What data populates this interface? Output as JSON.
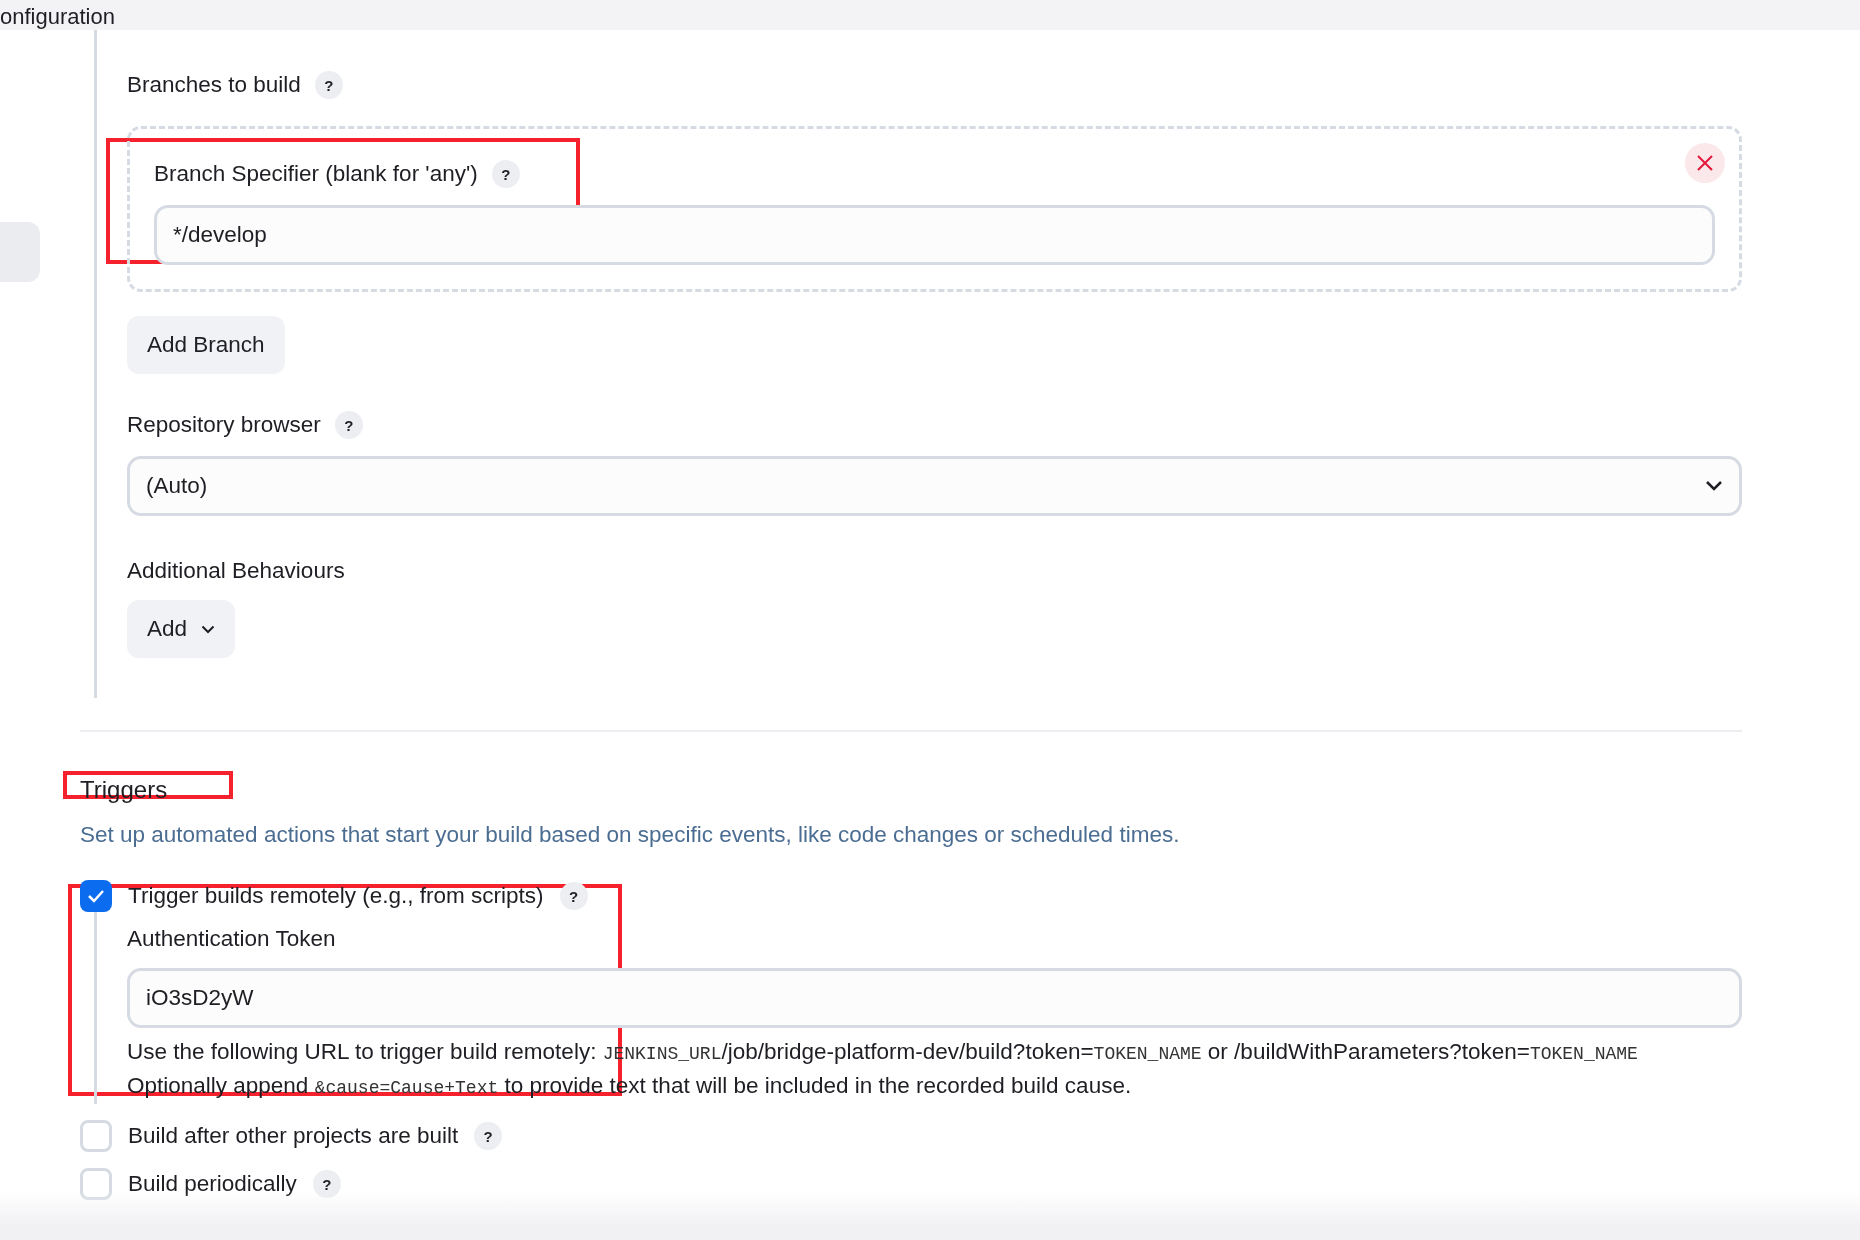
{
  "header": {
    "title": "onfiguration"
  },
  "branches": {
    "label": "Branches to build",
    "help": "?",
    "specifiers": [
      {
        "label": "Branch Specifier (blank for 'any')",
        "help": "?",
        "value": "*/develop"
      }
    ],
    "add_button": "Add Branch"
  },
  "repository_browser": {
    "label": "Repository browser",
    "help": "?",
    "value": "(Auto)"
  },
  "additional_behaviours": {
    "label": "Additional Behaviours",
    "add_button": "Add"
  },
  "triggers": {
    "title": "Triggers",
    "description": "Set up automated actions that start your build based on specific events, like code changes or scheduled times.",
    "items": [
      {
        "label": "Trigger builds remotely (e.g., from scripts)",
        "help": "?",
        "checked": true,
        "token_label": "Authentication Token",
        "token_value": "iO3sD2yW",
        "help_lines": [
          [
            {
              "text": "Use the following URL to trigger build remotely: ",
              "mono": false
            },
            {
              "text": "JENKINS_URL",
              "mono": true
            },
            {
              "text": "/job/bridge-platform-dev/build?token=",
              "mono": false
            },
            {
              "text": "TOKEN_NAME",
              "mono": true
            },
            {
              "text": " or /buildWithParameters?token=",
              "mono": false
            },
            {
              "text": "TOKEN_NAME",
              "mono": true
            }
          ],
          [
            {
              "text": "Optionally append ",
              "mono": false
            },
            {
              "text": "&cause=Cause+Text",
              "mono": true
            },
            {
              "text": " to provide text that will be included in the recorded build cause.",
              "mono": false
            }
          ]
        ]
      },
      {
        "label": "Build after other projects are built",
        "help": "?",
        "checked": false
      },
      {
        "label": "Build periodically",
        "help": "?",
        "checked": false
      }
    ]
  }
}
